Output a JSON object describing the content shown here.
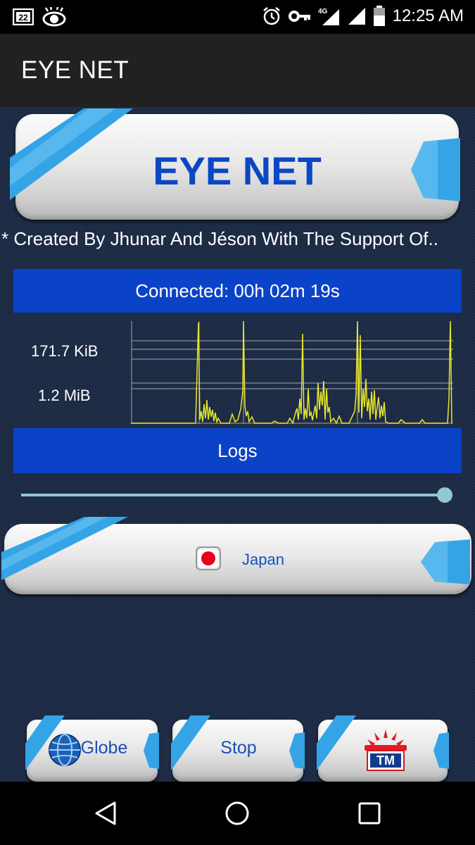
{
  "status_bar": {
    "notification_badge": "22",
    "network": "4G",
    "time": "12:25 AM"
  },
  "app_bar": {
    "title": "EYE NET"
  },
  "banner": {
    "title": "EYE NET"
  },
  "credit_text": "* Created By Jhunar And Jéson With The Support Of..",
  "connection": {
    "status": "Connected: 00h 02m 19s"
  },
  "traffic_graph": {
    "upload_label": "171.7 KiB",
    "download_label": "1.2 MiB"
  },
  "logs_button": {
    "label": "Logs"
  },
  "slider": {
    "value": 1.0
  },
  "server": {
    "label": "Japan"
  },
  "bottom_buttons": {
    "globe_label": "Globe",
    "stop_label": "Stop",
    "tm_label": "TM"
  },
  "colors": {
    "accent_blue": "#0b43c8",
    "background": "#1c2a44",
    "graph_line": "#e8e82a",
    "slider": "#8fc9cf"
  }
}
